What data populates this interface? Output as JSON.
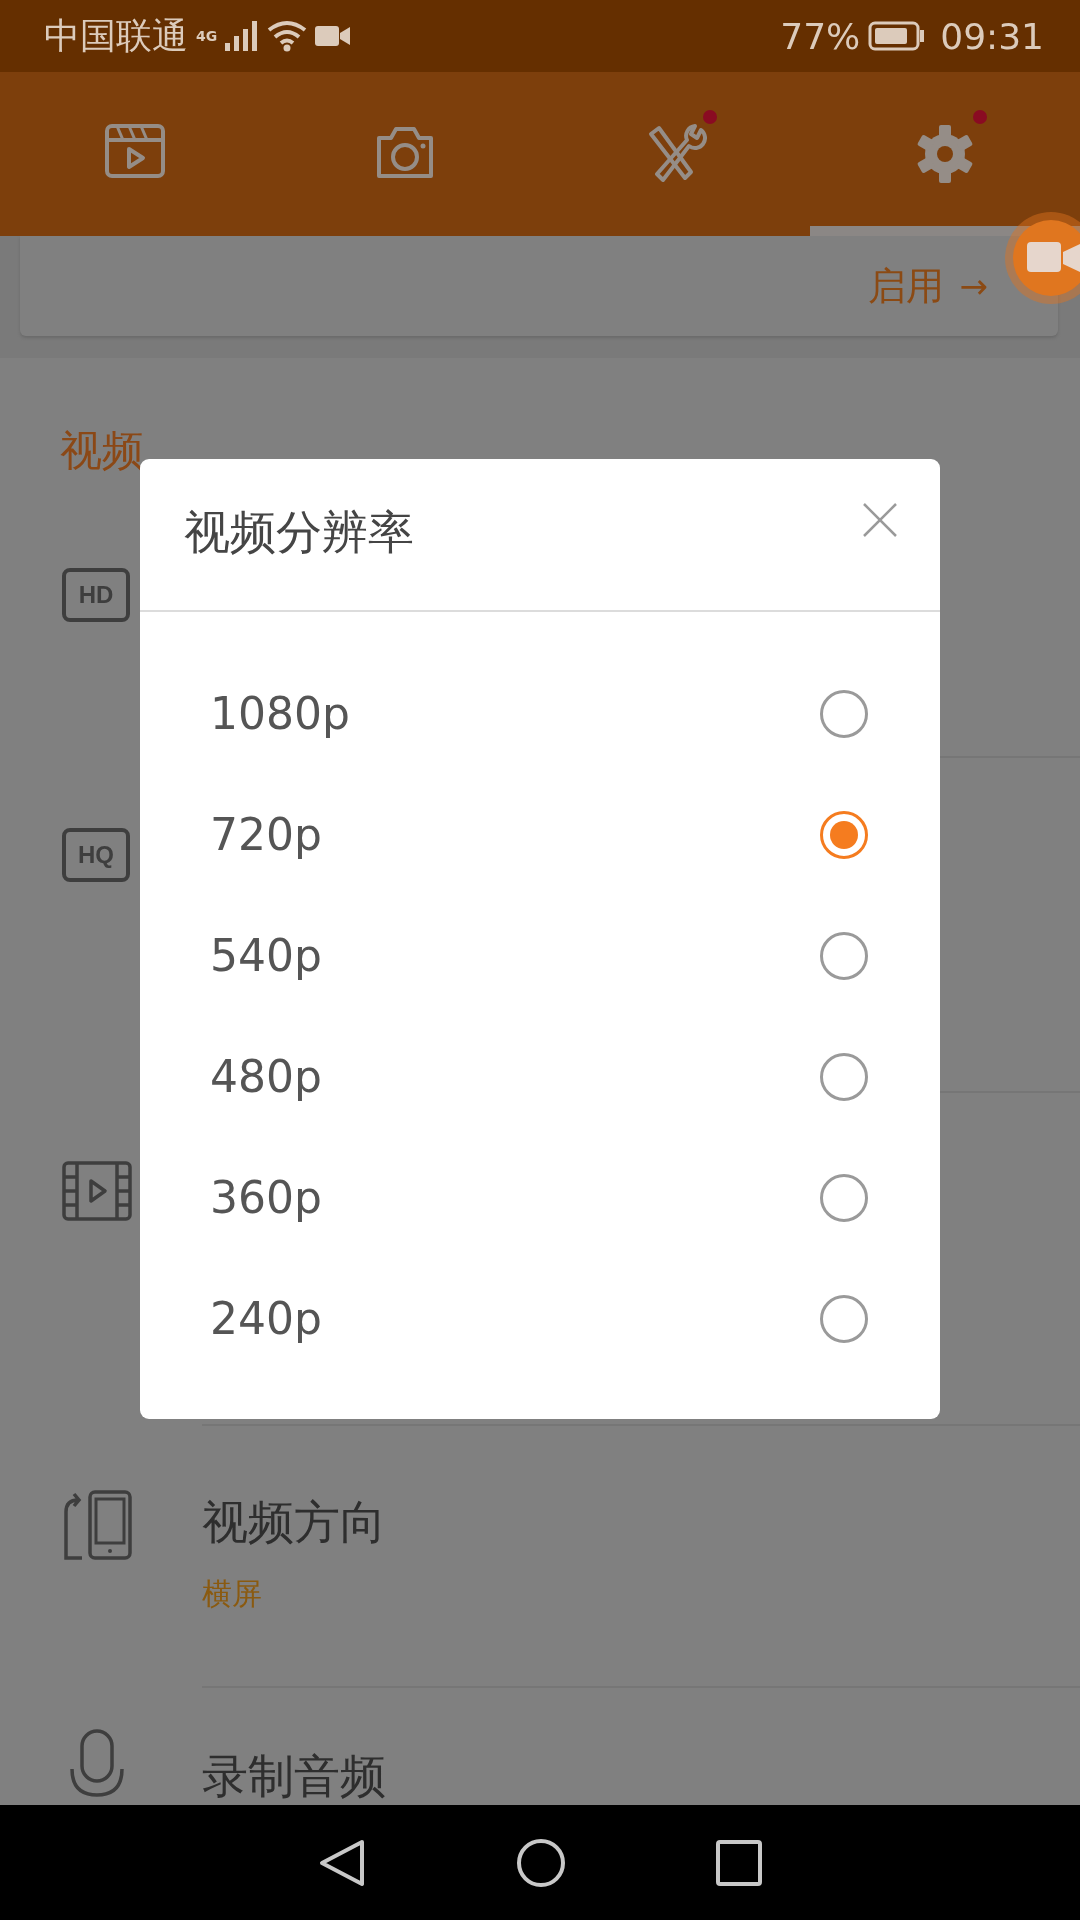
{
  "status_bar": {
    "carrier": "中国联通",
    "network": "4G",
    "battery": "77%",
    "time": "09:31"
  },
  "tabs": [
    {
      "kind": "clip",
      "selected": false,
      "badge": false
    },
    {
      "kind": "camera",
      "selected": false,
      "badge": false
    },
    {
      "kind": "tools",
      "selected": false,
      "badge": true
    },
    {
      "kind": "settings",
      "selected": true,
      "badge": true
    }
  ],
  "banner": {
    "action": "启用",
    "arrow": "→"
  },
  "section": {
    "title": "视频"
  },
  "settings": [
    {
      "kind": "hd",
      "icon_text": "HD"
    },
    {
      "kind": "hq",
      "icon_text": "HQ"
    },
    {
      "kind": "film"
    },
    {
      "kind": "rotate",
      "title": "视频方向",
      "value": "横屏"
    },
    {
      "kind": "mic",
      "title": "录制音频"
    }
  ],
  "dialog": {
    "title": "视频分辨率",
    "options": [
      {
        "label": "1080p",
        "selected": false
      },
      {
        "label": "720p",
        "selected": true
      },
      {
        "label": "540p",
        "selected": false
      },
      {
        "label": "480p",
        "selected": false
      },
      {
        "label": "360p",
        "selected": false
      },
      {
        "label": "240p",
        "selected": false
      }
    ]
  }
}
